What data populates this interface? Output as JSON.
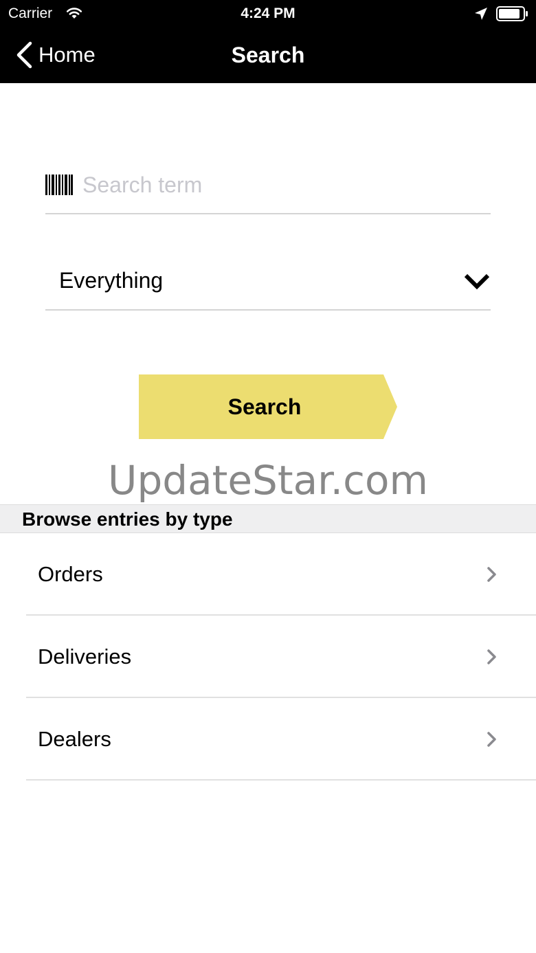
{
  "status_bar": {
    "carrier": "Carrier",
    "time": "4:24 PM",
    "icons": [
      "wifi-icon",
      "location-icon",
      "battery-icon"
    ]
  },
  "nav": {
    "back_label": "Home",
    "title": "Search",
    "back_icon": "chevron-left-icon"
  },
  "search": {
    "placeholder": "Search term",
    "value": "",
    "icon": "barcode-icon"
  },
  "scope": {
    "selected": "Everything",
    "icon": "chevron-down-icon"
  },
  "search_button": {
    "label": "Search",
    "color": "#ecdd70"
  },
  "watermark": "UpdateStar.com",
  "browse": {
    "header": "Browse entries by type",
    "items": [
      {
        "label": "Orders",
        "icon": "chevron-right-icon"
      },
      {
        "label": "Deliveries",
        "icon": "chevron-right-icon"
      },
      {
        "label": "Dealers",
        "icon": "chevron-right-icon"
      }
    ]
  },
  "colors": {
    "bar_background": "#000000",
    "accent": "#ecdd70",
    "section_background": "#efeff0"
  }
}
